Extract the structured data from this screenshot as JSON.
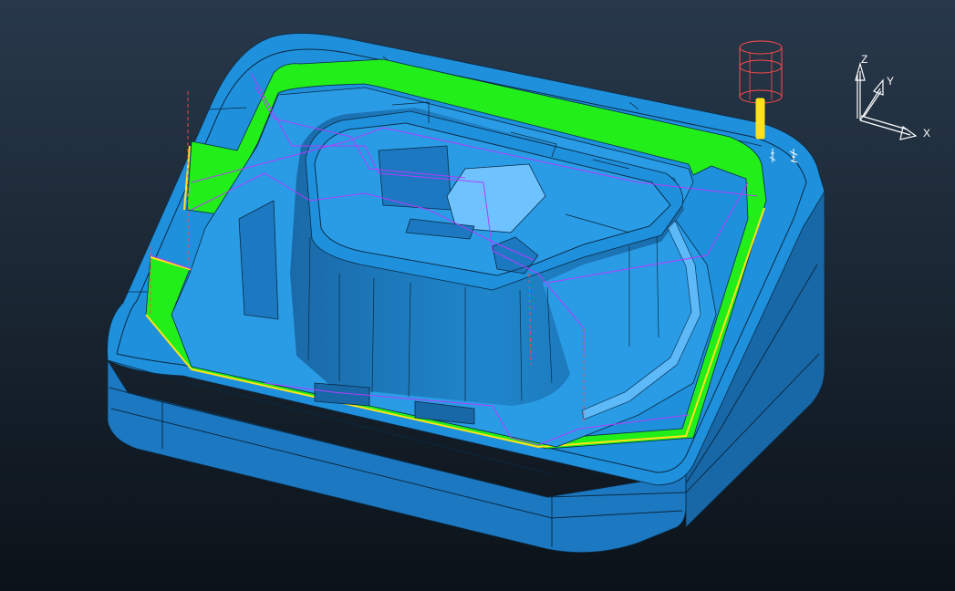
{
  "viewport": {
    "background_top": "#28394b",
    "background_bottom": "#0b1219"
  },
  "colors": {
    "mold_face": "#1f90dc",
    "mold_side": "#1c79c1",
    "mold_side_dark": "#1868a8",
    "mold_edge": "#0a2a44",
    "cavity_wall": "#1b74b6",
    "cavity_floor": "#2a9ce6",
    "highlight": "#6ec3ff",
    "toolpath_fill": "#22ee1a",
    "toolpath_edge": "#ffe21a",
    "guide_lines": "#b33dff",
    "tool_holder": "#ff4a4a",
    "tool_shank": "#ffe21a",
    "triad": "#ffffff"
  },
  "axis_triad": {
    "x_label": "X",
    "y_label": "Y",
    "z_label": "Z"
  }
}
